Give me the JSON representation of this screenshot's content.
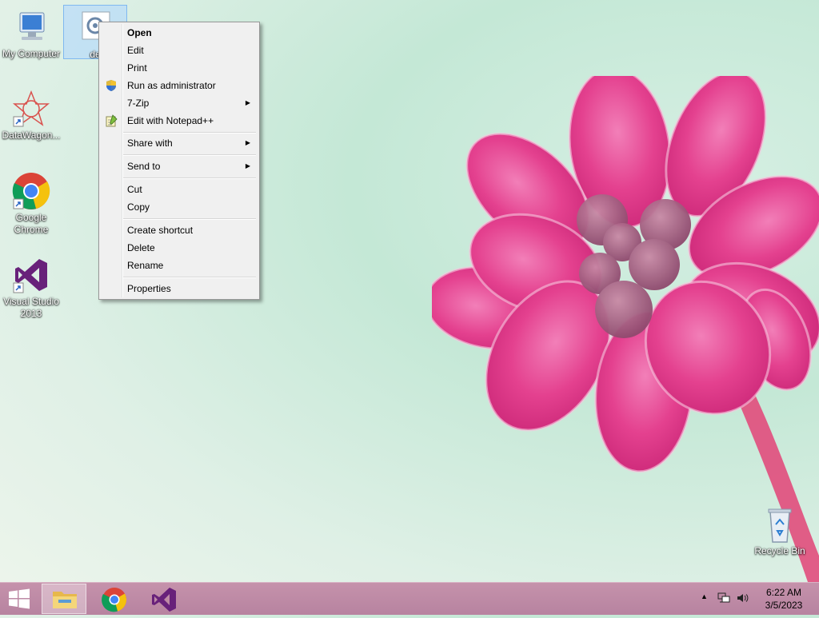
{
  "desktop": {
    "icons": [
      {
        "label": "My Computer"
      },
      {
        "label": "de"
      },
      {
        "label": "DataWagon..."
      },
      {
        "label": "Google Chrome"
      },
      {
        "label": "Visual Studio 2013"
      },
      {
        "label": "Recycle Bin"
      }
    ]
  },
  "context_menu": {
    "items": [
      {
        "label": "Open"
      },
      {
        "label": "Edit"
      },
      {
        "label": "Print"
      },
      {
        "label": "Run as administrator",
        "icon": "shield-icon"
      },
      {
        "label": "7-Zip"
      },
      {
        "label": "Edit with Notepad++",
        "icon": "notepad-icon"
      },
      {
        "label": "Share with"
      },
      {
        "label": "Send to"
      },
      {
        "label": "Cut"
      },
      {
        "label": "Copy"
      },
      {
        "label": "Create shortcut"
      },
      {
        "label": "Delete"
      },
      {
        "label": "Rename"
      },
      {
        "label": "Properties"
      }
    ]
  },
  "taskbar": {
    "start": "windows-logo-icon",
    "pinned": [
      "file-explorer-icon",
      "chrome-icon",
      "visual-studio-icon"
    ],
    "clock": {
      "time": "6:22 AM",
      "date": "3/5/2023"
    }
  },
  "colors": {
    "menu_bg": "#f0f0f0",
    "taskbar": "#bf8ba7",
    "flower": "#e0408a"
  }
}
